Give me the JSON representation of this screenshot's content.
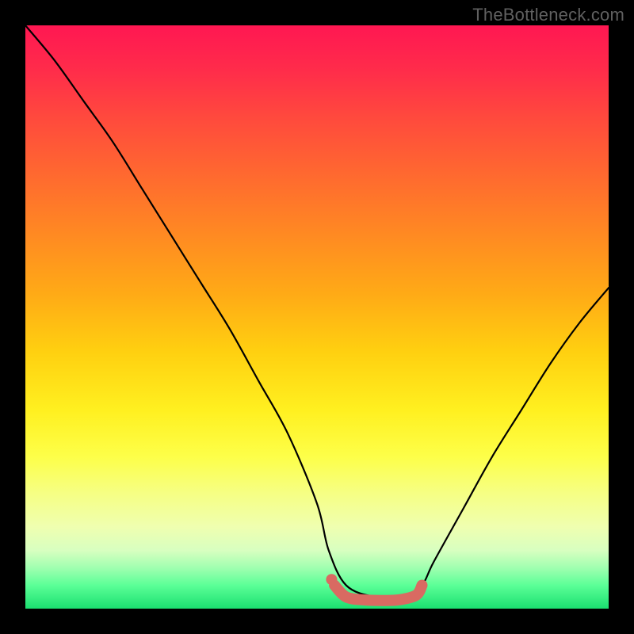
{
  "attribution": "TheBottleneck.com",
  "chart_data": {
    "type": "line",
    "title": "",
    "xlabel": "",
    "ylabel": "",
    "xlim": [
      0,
      100
    ],
    "ylim": [
      0,
      100
    ],
    "series": [
      {
        "name": "bottleneck-curve",
        "x": [
          0,
          5,
          10,
          15,
          20,
          25,
          30,
          35,
          40,
          45,
          50,
          52,
          55,
          60,
          65,
          68,
          70,
          75,
          80,
          85,
          90,
          95,
          100
        ],
        "values": [
          100,
          94,
          87,
          80,
          72,
          64,
          56,
          48,
          39,
          30,
          18,
          10,
          4,
          2,
          2,
          4,
          8,
          17,
          26,
          34,
          42,
          49,
          55
        ]
      },
      {
        "name": "highlight-band",
        "x": [
          53,
          55,
          58,
          61,
          64,
          67,
          68
        ],
        "values": [
          4,
          2,
          1.5,
          1.4,
          1.5,
          2.3,
          4
        ]
      }
    ],
    "highlight_marker": {
      "x": 52.5,
      "value": 5
    },
    "colors": {
      "curve": "#000000",
      "highlight": "#d96a62"
    }
  }
}
